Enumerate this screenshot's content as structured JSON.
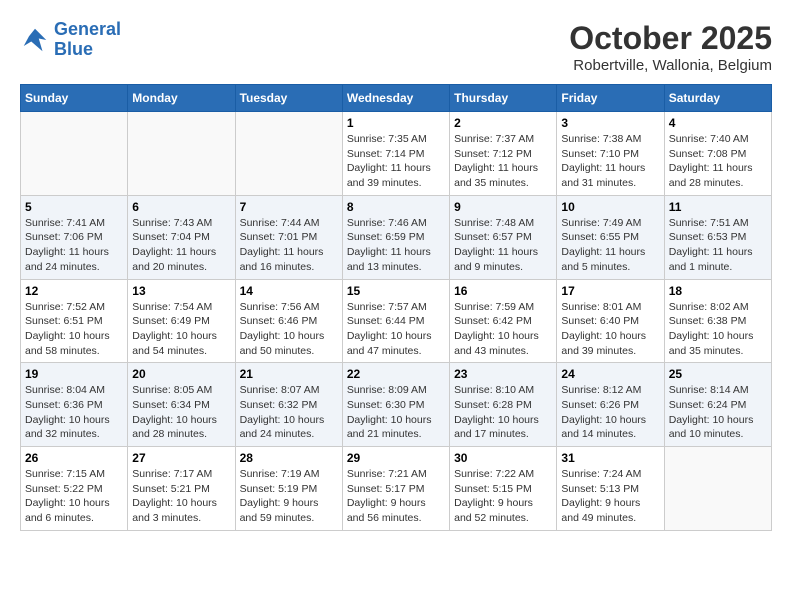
{
  "header": {
    "logo_general": "General",
    "logo_blue": "Blue",
    "month_title": "October 2025",
    "location": "Robertville, Wallonia, Belgium"
  },
  "days_of_week": [
    "Sunday",
    "Monday",
    "Tuesday",
    "Wednesday",
    "Thursday",
    "Friday",
    "Saturday"
  ],
  "weeks": [
    [
      {
        "day": "",
        "info": ""
      },
      {
        "day": "",
        "info": ""
      },
      {
        "day": "",
        "info": ""
      },
      {
        "day": "1",
        "info": "Sunrise: 7:35 AM\nSunset: 7:14 PM\nDaylight: 11 hours\nand 39 minutes."
      },
      {
        "day": "2",
        "info": "Sunrise: 7:37 AM\nSunset: 7:12 PM\nDaylight: 11 hours\nand 35 minutes."
      },
      {
        "day": "3",
        "info": "Sunrise: 7:38 AM\nSunset: 7:10 PM\nDaylight: 11 hours\nand 31 minutes."
      },
      {
        "day": "4",
        "info": "Sunrise: 7:40 AM\nSunset: 7:08 PM\nDaylight: 11 hours\nand 28 minutes."
      }
    ],
    [
      {
        "day": "5",
        "info": "Sunrise: 7:41 AM\nSunset: 7:06 PM\nDaylight: 11 hours\nand 24 minutes."
      },
      {
        "day": "6",
        "info": "Sunrise: 7:43 AM\nSunset: 7:04 PM\nDaylight: 11 hours\nand 20 minutes."
      },
      {
        "day": "7",
        "info": "Sunrise: 7:44 AM\nSunset: 7:01 PM\nDaylight: 11 hours\nand 16 minutes."
      },
      {
        "day": "8",
        "info": "Sunrise: 7:46 AM\nSunset: 6:59 PM\nDaylight: 11 hours\nand 13 minutes."
      },
      {
        "day": "9",
        "info": "Sunrise: 7:48 AM\nSunset: 6:57 PM\nDaylight: 11 hours\nand 9 minutes."
      },
      {
        "day": "10",
        "info": "Sunrise: 7:49 AM\nSunset: 6:55 PM\nDaylight: 11 hours\nand 5 minutes."
      },
      {
        "day": "11",
        "info": "Sunrise: 7:51 AM\nSunset: 6:53 PM\nDaylight: 11 hours\nand 1 minute."
      }
    ],
    [
      {
        "day": "12",
        "info": "Sunrise: 7:52 AM\nSunset: 6:51 PM\nDaylight: 10 hours\nand 58 minutes."
      },
      {
        "day": "13",
        "info": "Sunrise: 7:54 AM\nSunset: 6:49 PM\nDaylight: 10 hours\nand 54 minutes."
      },
      {
        "day": "14",
        "info": "Sunrise: 7:56 AM\nSunset: 6:46 PM\nDaylight: 10 hours\nand 50 minutes."
      },
      {
        "day": "15",
        "info": "Sunrise: 7:57 AM\nSunset: 6:44 PM\nDaylight: 10 hours\nand 47 minutes."
      },
      {
        "day": "16",
        "info": "Sunrise: 7:59 AM\nSunset: 6:42 PM\nDaylight: 10 hours\nand 43 minutes."
      },
      {
        "day": "17",
        "info": "Sunrise: 8:01 AM\nSunset: 6:40 PM\nDaylight: 10 hours\nand 39 minutes."
      },
      {
        "day": "18",
        "info": "Sunrise: 8:02 AM\nSunset: 6:38 PM\nDaylight: 10 hours\nand 35 minutes."
      }
    ],
    [
      {
        "day": "19",
        "info": "Sunrise: 8:04 AM\nSunset: 6:36 PM\nDaylight: 10 hours\nand 32 minutes."
      },
      {
        "day": "20",
        "info": "Sunrise: 8:05 AM\nSunset: 6:34 PM\nDaylight: 10 hours\nand 28 minutes."
      },
      {
        "day": "21",
        "info": "Sunrise: 8:07 AM\nSunset: 6:32 PM\nDaylight: 10 hours\nand 24 minutes."
      },
      {
        "day": "22",
        "info": "Sunrise: 8:09 AM\nSunset: 6:30 PM\nDaylight: 10 hours\nand 21 minutes."
      },
      {
        "day": "23",
        "info": "Sunrise: 8:10 AM\nSunset: 6:28 PM\nDaylight: 10 hours\nand 17 minutes."
      },
      {
        "day": "24",
        "info": "Sunrise: 8:12 AM\nSunset: 6:26 PM\nDaylight: 10 hours\nand 14 minutes."
      },
      {
        "day": "25",
        "info": "Sunrise: 8:14 AM\nSunset: 6:24 PM\nDaylight: 10 hours\nand 10 minutes."
      }
    ],
    [
      {
        "day": "26",
        "info": "Sunrise: 7:15 AM\nSunset: 5:22 PM\nDaylight: 10 hours\nand 6 minutes."
      },
      {
        "day": "27",
        "info": "Sunrise: 7:17 AM\nSunset: 5:21 PM\nDaylight: 10 hours\nand 3 minutes."
      },
      {
        "day": "28",
        "info": "Sunrise: 7:19 AM\nSunset: 5:19 PM\nDaylight: 9 hours\nand 59 minutes."
      },
      {
        "day": "29",
        "info": "Sunrise: 7:21 AM\nSunset: 5:17 PM\nDaylight: 9 hours\nand 56 minutes."
      },
      {
        "day": "30",
        "info": "Sunrise: 7:22 AM\nSunset: 5:15 PM\nDaylight: 9 hours\nand 52 minutes."
      },
      {
        "day": "31",
        "info": "Sunrise: 7:24 AM\nSunset: 5:13 PM\nDaylight: 9 hours\nand 49 minutes."
      },
      {
        "day": "",
        "info": ""
      }
    ]
  ]
}
